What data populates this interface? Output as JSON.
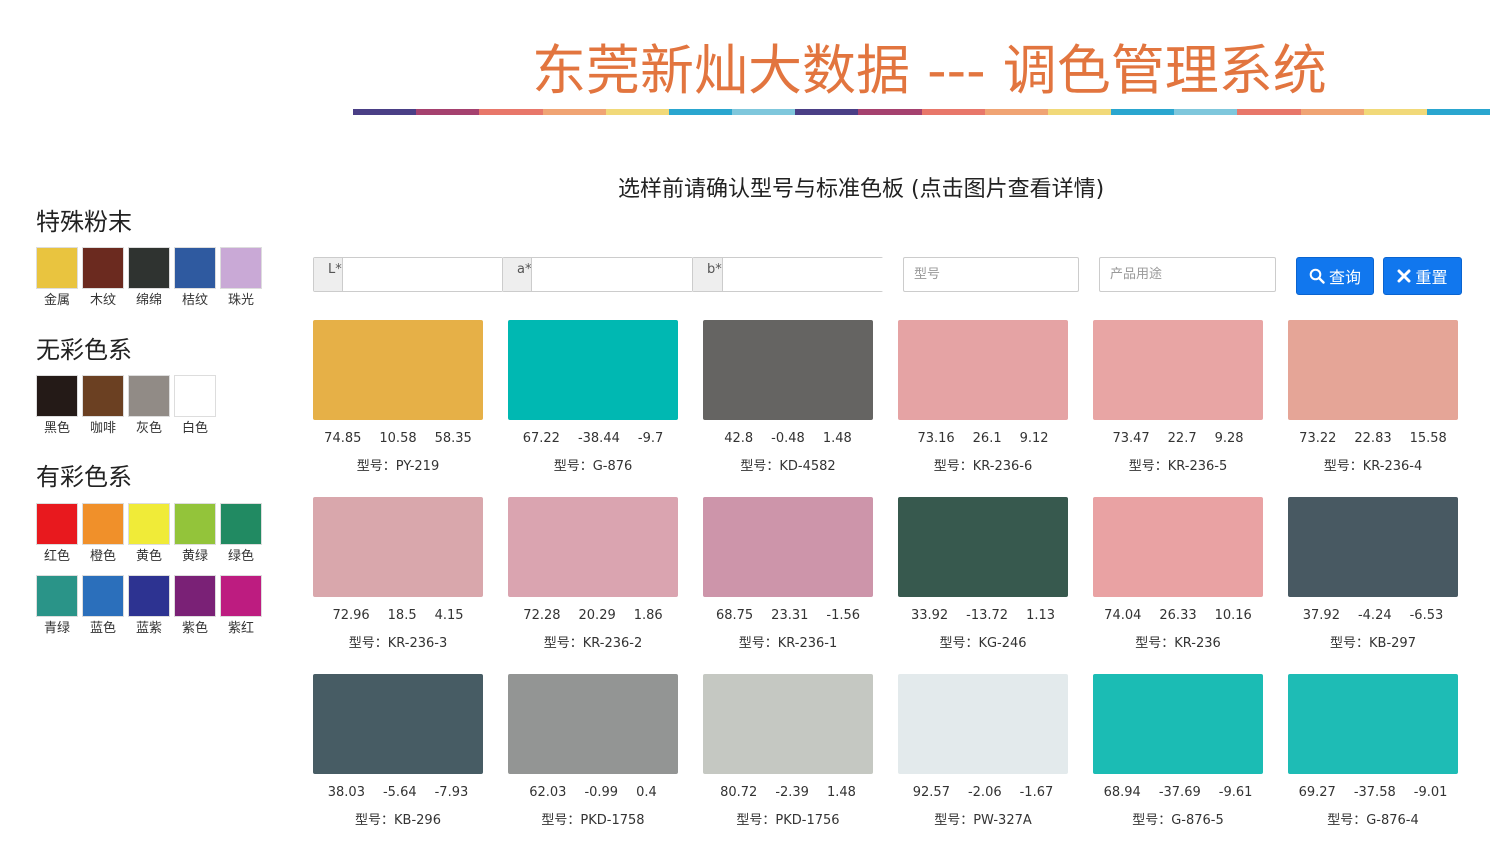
{
  "header": {
    "title": "东莞新灿大数据 --- 调色管理系统",
    "bar_colors": [
      "#4a3f86",
      "#a5416f",
      "#e8776a",
      "#f0a474",
      "#f1d979",
      "#2aa6cf",
      "#7fc7dc",
      "#4a3f86",
      "#a5416f",
      "#e8776a",
      "#f0a474",
      "#f1d979",
      "#2aa6cf",
      "#7fc7dc",
      "#e8776a",
      "#f0a474",
      "#f1d979",
      "#2aa6cf"
    ]
  },
  "instruction": "选样前请确认型号与标准色板 (点击图片查看详情)",
  "sidebar": {
    "categories": [
      {
        "title": "特殊粉末",
        "items": [
          {
            "label": "金属",
            "color": "#e9c43f"
          },
          {
            "label": "木纹",
            "color": "#6b2a1f"
          },
          {
            "label": "绵绵",
            "color": "#2f3330"
          },
          {
            "label": "桔纹",
            "color": "#2f5aa0"
          },
          {
            "label": "珠光",
            "color": "#c9a9d6"
          }
        ]
      },
      {
        "title": "无彩色系",
        "items": [
          {
            "label": "黑色",
            "color": "#241a17"
          },
          {
            "label": "咖啡",
            "color": "#6b4022"
          },
          {
            "label": "灰色",
            "color": "#918b86"
          },
          {
            "label": "白色",
            "color": "#ffffff"
          }
        ]
      },
      {
        "title": "有彩色系",
        "items": [
          {
            "label": "红色",
            "color": "#e8191e"
          },
          {
            "label": "橙色",
            "color": "#f0902a"
          },
          {
            "label": "黄色",
            "color": "#f0eb38"
          },
          {
            "label": "黄绿",
            "color": "#93c43a"
          },
          {
            "label": "绿色",
            "color": "#218a62"
          },
          {
            "label": "青绿",
            "color": "#2a9488"
          },
          {
            "label": "蓝色",
            "color": "#2b6fbb"
          },
          {
            "label": "蓝紫",
            "color": "#2d3391"
          },
          {
            "label": "紫色",
            "color": "#7a2176"
          },
          {
            "label": "紫红",
            "color": "#bd1c80"
          }
        ]
      }
    ]
  },
  "search": {
    "l_label": "L*",
    "a_label": "a*",
    "b_label": "b*",
    "l_value": "",
    "a_value": "",
    "b_value": "",
    "model_placeholder": "型号",
    "usage_placeholder": "产品用途",
    "query_label": "查询",
    "reset_label": "重置"
  },
  "cards": [
    {
      "color": "#e6b047",
      "l": "74.85",
      "a": "10.58",
      "b": "58.35",
      "model": "型号：PY-219"
    },
    {
      "color": "#00b8b2",
      "l": "67.22",
      "a": "-38.44",
      "b": "-9.7",
      "model": "型号：G-876"
    },
    {
      "color": "#656462",
      "l": "42.8",
      "a": "-0.48",
      "b": "1.48",
      "model": "型号：KD-4582"
    },
    {
      "color": "#e5a3a4",
      "l": "73.16",
      "a": "26.1",
      "b": "9.12",
      "model": "型号：KR-236-6"
    },
    {
      "color": "#e8a5a4",
      "l": "73.47",
      "a": "22.7",
      "b": "9.28",
      "model": "型号：KR-236-5"
    },
    {
      "color": "#e5a597",
      "l": "73.22",
      "a": "22.83",
      "b": "15.58",
      "model": "型号：KR-236-4"
    },
    {
      "color": "#d9a7ac",
      "l": "72.96",
      "a": "18.5",
      "b": "4.15",
      "model": "型号：KR-236-3"
    },
    {
      "color": "#daa4b0",
      "l": "72.28",
      "a": "20.29",
      "b": "1.86",
      "model": "型号：KR-236-2"
    },
    {
      "color": "#cd95aa",
      "l": "68.75",
      "a": "23.31",
      "b": "-1.56",
      "model": "型号：KR-236-1"
    },
    {
      "color": "#37594e",
      "l": "33.92",
      "a": "-13.72",
      "b": "1.13",
      "model": "型号：KG-246"
    },
    {
      "color": "#e9a2a3",
      "l": "74.04",
      "a": "26.33",
      "b": "10.16",
      "model": "型号：KR-236"
    },
    {
      "color": "#485962",
      "l": "37.92",
      "a": "-4.24",
      "b": "-6.53",
      "model": "型号：KB-297"
    },
    {
      "color": "#475c64",
      "l": "38.03",
      "a": "-5.64",
      "b": "-7.93",
      "model": "型号：KB-296"
    },
    {
      "color": "#939594",
      "l": "62.03",
      "a": "-0.99",
      "b": "0.4",
      "model": "型号：PKD-1758"
    },
    {
      "color": "#c5c8c2",
      "l": "80.72",
      "a": "-2.39",
      "b": "1.48",
      "model": "型号：PKD-1756"
    },
    {
      "color": "#e3eaec",
      "l": "92.57",
      "a": "-2.06",
      "b": "-1.67",
      "model": "型号：PW-327A"
    },
    {
      "color": "#1bbcb4",
      "l": "68.94",
      "a": "-37.69",
      "b": "-9.61",
      "model": "型号：G-876-5"
    },
    {
      "color": "#1ebcb5",
      "l": "69.27",
      "a": "-37.58",
      "b": "-9.01",
      "model": "型号：G-876-4"
    }
  ]
}
